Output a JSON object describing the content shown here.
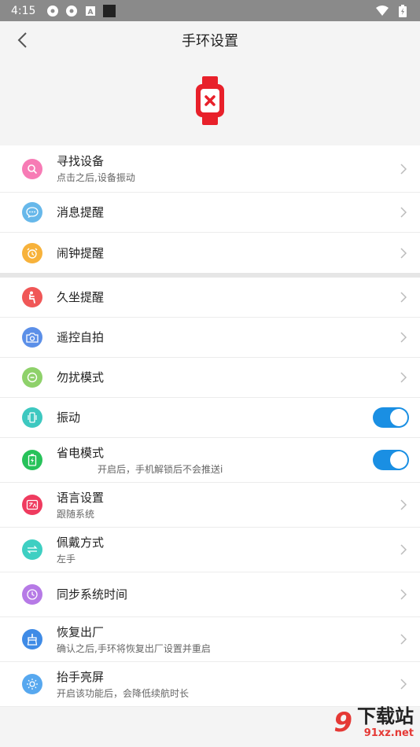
{
  "status": {
    "time": "4:15"
  },
  "header": {
    "title": "手环设置"
  },
  "items": {
    "find": {
      "label": "寻找设备",
      "sub": "点击之后,设备振动",
      "color": "#f77bb5"
    },
    "msg": {
      "label": "消息提醒",
      "color": "#67b8ea"
    },
    "alarm": {
      "label": "闹钟提醒",
      "color": "#f7b23b"
    },
    "sit": {
      "label": "久坐提醒",
      "color": "#f05757"
    },
    "selfie": {
      "label": "遥控自拍",
      "color": "#5b8fe8"
    },
    "dnd": {
      "label": "勿扰模式",
      "color": "#8ed16a"
    },
    "vibrate": {
      "label": "振动",
      "color": "#3dc8c0",
      "on": true
    },
    "power": {
      "label": "省电模式",
      "sub": "开启后，手机解锁后不会推送i",
      "color": "#27c25a",
      "on": true
    },
    "lang": {
      "label": "语言设置",
      "sub": "跟随系统",
      "color": "#ef3b5f"
    },
    "wear": {
      "label": "佩戴方式",
      "sub": "左手",
      "color": "#3ecfc2"
    },
    "sync": {
      "label": "同步系统时间",
      "color": "#b67ae6"
    },
    "reset": {
      "label": "恢复出厂",
      "sub": "确认之后,手环将恢复出厂设置并重启",
      "color": "#3f8be6"
    },
    "raise": {
      "label": "抬手亮屏",
      "sub": "开启该功能后，会降低续航时长",
      "color": "#57a8ef"
    }
  },
  "watermark": {
    "brand": "下载站",
    "site": "91xz.net",
    "logo": "9"
  }
}
